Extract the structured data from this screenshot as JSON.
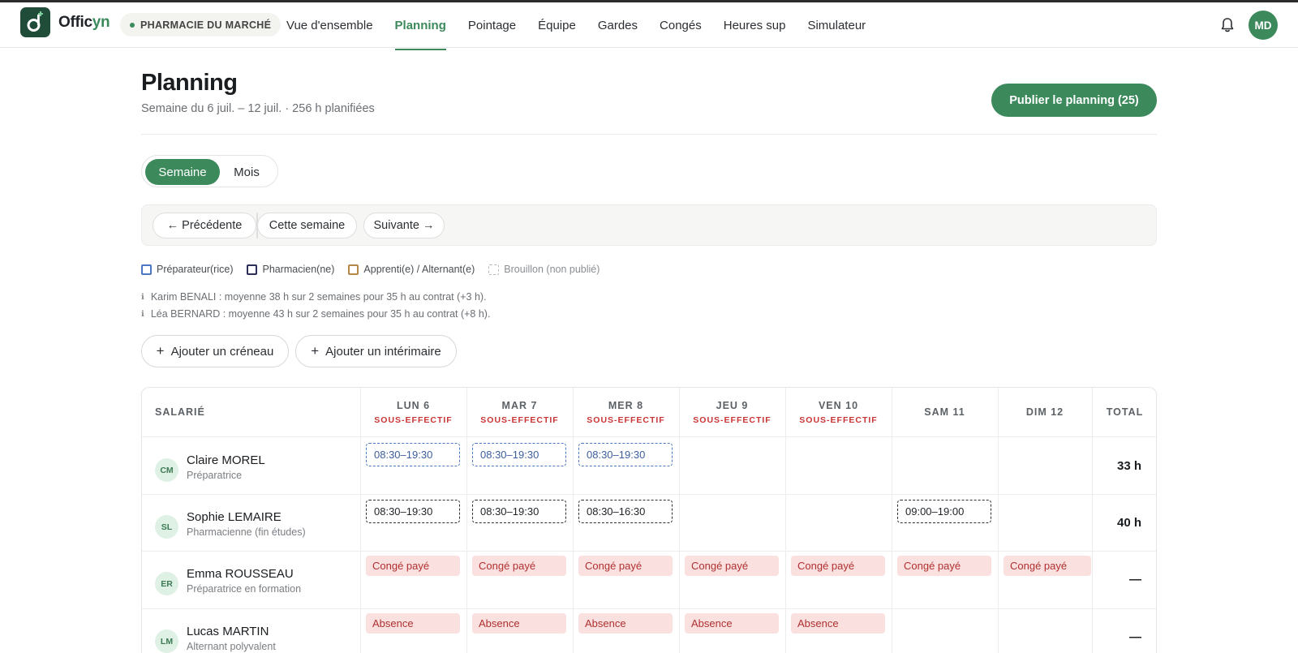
{
  "app": {
    "brand_main": "Offic",
    "brand_accent": "yn",
    "pharmacy": "PHARMACIE DU MARCHÉ",
    "user_initials": "MD",
    "accent_color": "#3c8a5c"
  },
  "nav": {
    "items": [
      {
        "label": "Vue d'ensemble"
      },
      {
        "label": "Planning"
      },
      {
        "label": "Pointage"
      },
      {
        "label": "Équipe"
      },
      {
        "label": "Gardes"
      },
      {
        "label": "Congés"
      },
      {
        "label": "Heures sup"
      },
      {
        "label": "Simulateur"
      }
    ],
    "active": "Planning"
  },
  "header": {
    "title": "Planning",
    "subtitle": "Semaine du 6 juil. – 12 juil. · 256 h planifiées",
    "publish_label": "Publier le planning (25)"
  },
  "view_toggle": {
    "week": "Semaine",
    "month": "Mois"
  },
  "week_nav": {
    "prev": "← Précédente",
    "current": "Cette semaine",
    "next": "Suivante →"
  },
  "legend": {
    "items": [
      {
        "label": "Préparateur(rice)",
        "color": "#4a78c2"
      },
      {
        "label": "Pharmacien(ne)",
        "color": "#2b2f5a"
      },
      {
        "label": "Apprenti(e) / Alternant(e)",
        "color": "#b8874a"
      },
      {
        "label": "Brouillon (non publié)",
        "color": "#b8b8b8"
      }
    ]
  },
  "notes": [
    "Karim BENALI : moyenne 38 h sur 2 semaines pour 35 h au contrat (+3 h).",
    "Léa BERNARD : moyenne 43 h sur 2 semaines pour 35 h au contrat (+8 h)."
  ],
  "actions": {
    "add_slot": "Ajouter un créneau",
    "add_temp": "Ajouter un intérimaire"
  },
  "table": {
    "employee_header": "SALARIÉ",
    "total_header": "TOTAL",
    "days": [
      {
        "label": "LUN 6",
        "warning": "SOUS-EFFECTIF"
      },
      {
        "label": "MAR 7",
        "warning": "SOUS-EFFECTIF"
      },
      {
        "label": "MER 8",
        "warning": "SOUS-EFFECTIF"
      },
      {
        "label": "JEU 9",
        "warning": "SOUS-EFFECTIF"
      },
      {
        "label": "VEN 10",
        "warning": "SOUS-EFFECTIF"
      },
      {
        "label": "SAM 11",
        "warning": ""
      },
      {
        "label": "DIM 12",
        "warning": ""
      }
    ],
    "rows": [
      {
        "initials": "CM",
        "name": "Claire MOREL",
        "role": "Préparatrice",
        "total": "33 h",
        "cells": [
          {
            "kind": "prep",
            "text": "08:30–19:30"
          },
          {
            "kind": "prep",
            "text": "08:30–19:30"
          },
          {
            "kind": "prep",
            "text": "08:30–19:30"
          },
          null,
          null,
          null,
          null
        ]
      },
      {
        "initials": "SL",
        "name": "Sophie LEMAIRE",
        "role": "Pharmacienne (fin études)",
        "total": "40 h",
        "cells": [
          {
            "kind": "pharma",
            "text": "08:30–19:30"
          },
          {
            "kind": "pharma",
            "text": "08:30–19:30"
          },
          {
            "kind": "pharma",
            "text": "08:30–16:30"
          },
          null,
          null,
          {
            "kind": "pharma",
            "text": "09:00–19:00"
          },
          null
        ]
      },
      {
        "initials": "ER",
        "name": "Emma ROUSSEAU",
        "role": "Préparatrice en formation",
        "total": "—",
        "cells": [
          {
            "kind": "leave",
            "text": "Congé payé"
          },
          {
            "kind": "leave",
            "text": "Congé payé"
          },
          {
            "kind": "leave",
            "text": "Congé payé"
          },
          {
            "kind": "leave",
            "text": "Congé payé"
          },
          {
            "kind": "leave",
            "text": "Congé payé"
          },
          {
            "kind": "leave",
            "text": "Congé payé"
          },
          {
            "kind": "leave",
            "text": "Congé payé"
          }
        ]
      },
      {
        "initials": "LM",
        "name": "Lucas MARTIN",
        "role": "Alternant polyvalent",
        "total": "—",
        "cells": [
          {
            "kind": "leave",
            "text": "Absence"
          },
          {
            "kind": "leave",
            "text": "Absence"
          },
          {
            "kind": "leave",
            "text": "Absence"
          },
          {
            "kind": "leave",
            "text": "Absence"
          },
          {
            "kind": "leave",
            "text": "Absence"
          },
          null,
          null
        ]
      }
    ]
  }
}
